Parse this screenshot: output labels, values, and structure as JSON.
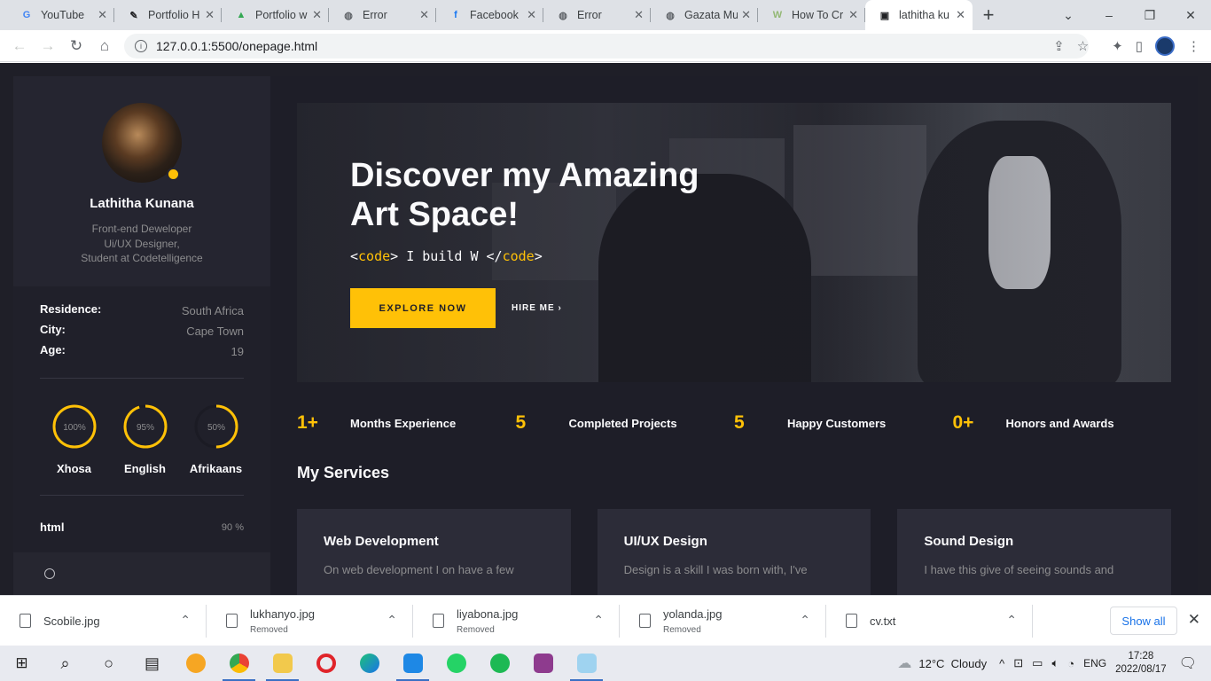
{
  "browser": {
    "tabs": [
      {
        "title": "YouTube",
        "icon": "google-icon",
        "color": "#4285f4",
        "glyph": "G"
      },
      {
        "title": "Portfolio H",
        "icon": "portfolio-icon",
        "color": "#202124",
        "glyph": "✎"
      },
      {
        "title": "Portfolio w",
        "icon": "drive-icon",
        "color": "#34a853",
        "glyph": "▲"
      },
      {
        "title": "Error",
        "icon": "globe-icon",
        "color": "#5f6368",
        "glyph": "◍"
      },
      {
        "title": "Facebook",
        "icon": "facebook-icon",
        "color": "#1877f2",
        "glyph": "f"
      },
      {
        "title": "Error",
        "icon": "globe-icon",
        "color": "#5f6368",
        "glyph": "◍"
      },
      {
        "title": "Gazata Mu",
        "icon": "globe-icon",
        "color": "#5f6368",
        "glyph": "◍"
      },
      {
        "title": "How To Cr",
        "icon": "wikihow-icon",
        "color": "#93b874",
        "glyph": "W"
      },
      {
        "title": "lathitha ku",
        "icon": "site-icon",
        "color": "#202124",
        "glyph": "▣",
        "active": true
      }
    ],
    "url": "127.0.0.1:5500/onepage.html"
  },
  "sidebar": {
    "name": "Lathitha Kunana",
    "role_line1": "Front-end Deweloper",
    "role_line2": "Ui/UX Designer,",
    "role_line3": "Student at Codetelligence",
    "info": [
      {
        "label": "Residence:",
        "value": "South Africa"
      },
      {
        "label": "City:",
        "value": "Cape Town"
      },
      {
        "label": "Age:",
        "value": "19"
      }
    ],
    "languages": [
      {
        "name": "Xhosa",
        "percent_label": "100%",
        "level": 1.0
      },
      {
        "name": "English",
        "percent_label": "95%",
        "level": 0.95
      },
      {
        "name": "Afrikaans",
        "percent_label": "50%",
        "level": 0.5
      }
    ],
    "skill": {
      "name": "html",
      "value": "90 %"
    }
  },
  "hero": {
    "title_line1": "Discover my Amazing",
    "title_line2": "Art Space!",
    "code_open": "<",
    "code_tag": "code",
    "code_close": ">",
    "code_text": " I build W ",
    "code_end_open": "</",
    "explore_label": "EXPLORE NOW",
    "hire_label": "HIRE ME"
  },
  "stats": [
    {
      "number": "1+",
      "label": "Months Experience"
    },
    {
      "number": "5",
      "label": "Completed Projects"
    },
    {
      "number": "5",
      "label": "Happy Customers"
    },
    {
      "number": "0+",
      "label": "Honors and Awards"
    }
  ],
  "services": {
    "title": "My Services",
    "cards": [
      {
        "title": "Web Development",
        "desc": "On web development I on have a few"
      },
      {
        "title": "UI/UX Design",
        "desc": "Design is a skill I was born with, I've"
      },
      {
        "title": "Sound Design",
        "desc": "I have this give of seeing sounds and"
      }
    ]
  },
  "downloads": {
    "items": [
      {
        "name": "Scobile.jpg",
        "status": ""
      },
      {
        "name": "lukhanyo.jpg",
        "status": "Removed"
      },
      {
        "name": "liyabona.jpg",
        "status": "Removed"
      },
      {
        "name": "yolanda.jpg",
        "status": "Removed"
      },
      {
        "name": "cv.txt",
        "status": ""
      }
    ],
    "show_all": "Show all"
  },
  "taskbar": {
    "weather": "12°C  Cloudy",
    "lang": "ENG",
    "time": "17:28",
    "date": "2022/08/17"
  },
  "colors": {
    "accent": "#ffc107",
    "page_bg": "#1e1e28"
  }
}
